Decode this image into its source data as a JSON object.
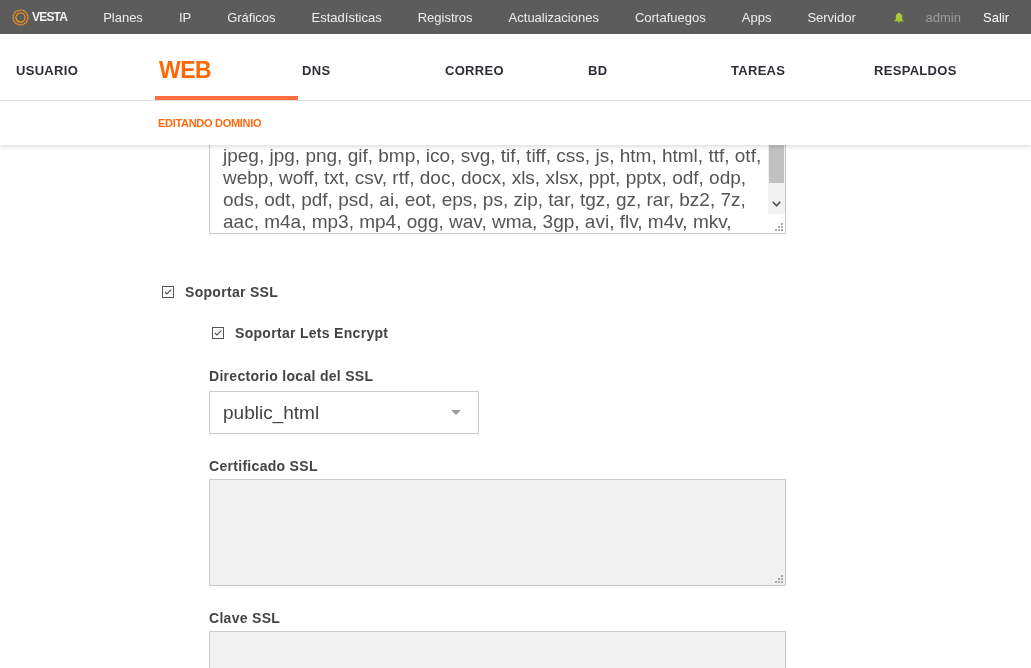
{
  "top_bar": {
    "logo": "VESTA",
    "nav": [
      "Planes",
      "IP",
      "Gráficos",
      "Estadísticas",
      "Registros",
      "Actualizaciones",
      "Cortafuegos",
      "Apps",
      "Servidor"
    ],
    "user": "admin",
    "logout": "Salir"
  },
  "tabs": [
    {
      "label": "USUARIO",
      "selected": false
    },
    {
      "label": "WEB",
      "selected": true
    },
    {
      "label": "DNS",
      "selected": false
    },
    {
      "label": "CORREO",
      "selected": false
    },
    {
      "label": "BD",
      "selected": false
    },
    {
      "label": "TAREAS",
      "selected": false
    },
    {
      "label": "RESPALDOS",
      "selected": false
    }
  ],
  "subheader": {
    "title": "EDITANDO DOMINIO"
  },
  "form": {
    "textarea_1": {
      "value": "jpeg, jpg, png, gif, bmp, ico, svg, tif, tiff, css, js, htm, html, ttf, otf, webp, woff, txt, csv, rtf, doc, docx, xls, xlsx, ppt, pptx, odf, odp, ods, odt, pdf, psd, ai, eot, eps, ps, zip, tar, tgz, gz, rar, bz2, 7z, aac, m4a, mp3, mp4, ogg, wav, wma, 3gp, avi, flv, m4v, mkv,"
    },
    "ssl": {
      "label": "Soportar SSL",
      "checked": true
    },
    "letsencrypt": {
      "label": "Soportar Lets Encrypt",
      "checked": true
    },
    "ssl_home": {
      "label": "Directorio local del SSL",
      "value": "public_html"
    },
    "ssl_certificate": {
      "label": "Certificado SSL",
      "disabled": true
    },
    "ssl_key": {
      "label": "Clave SSL",
      "disabled": true
    }
  }
}
